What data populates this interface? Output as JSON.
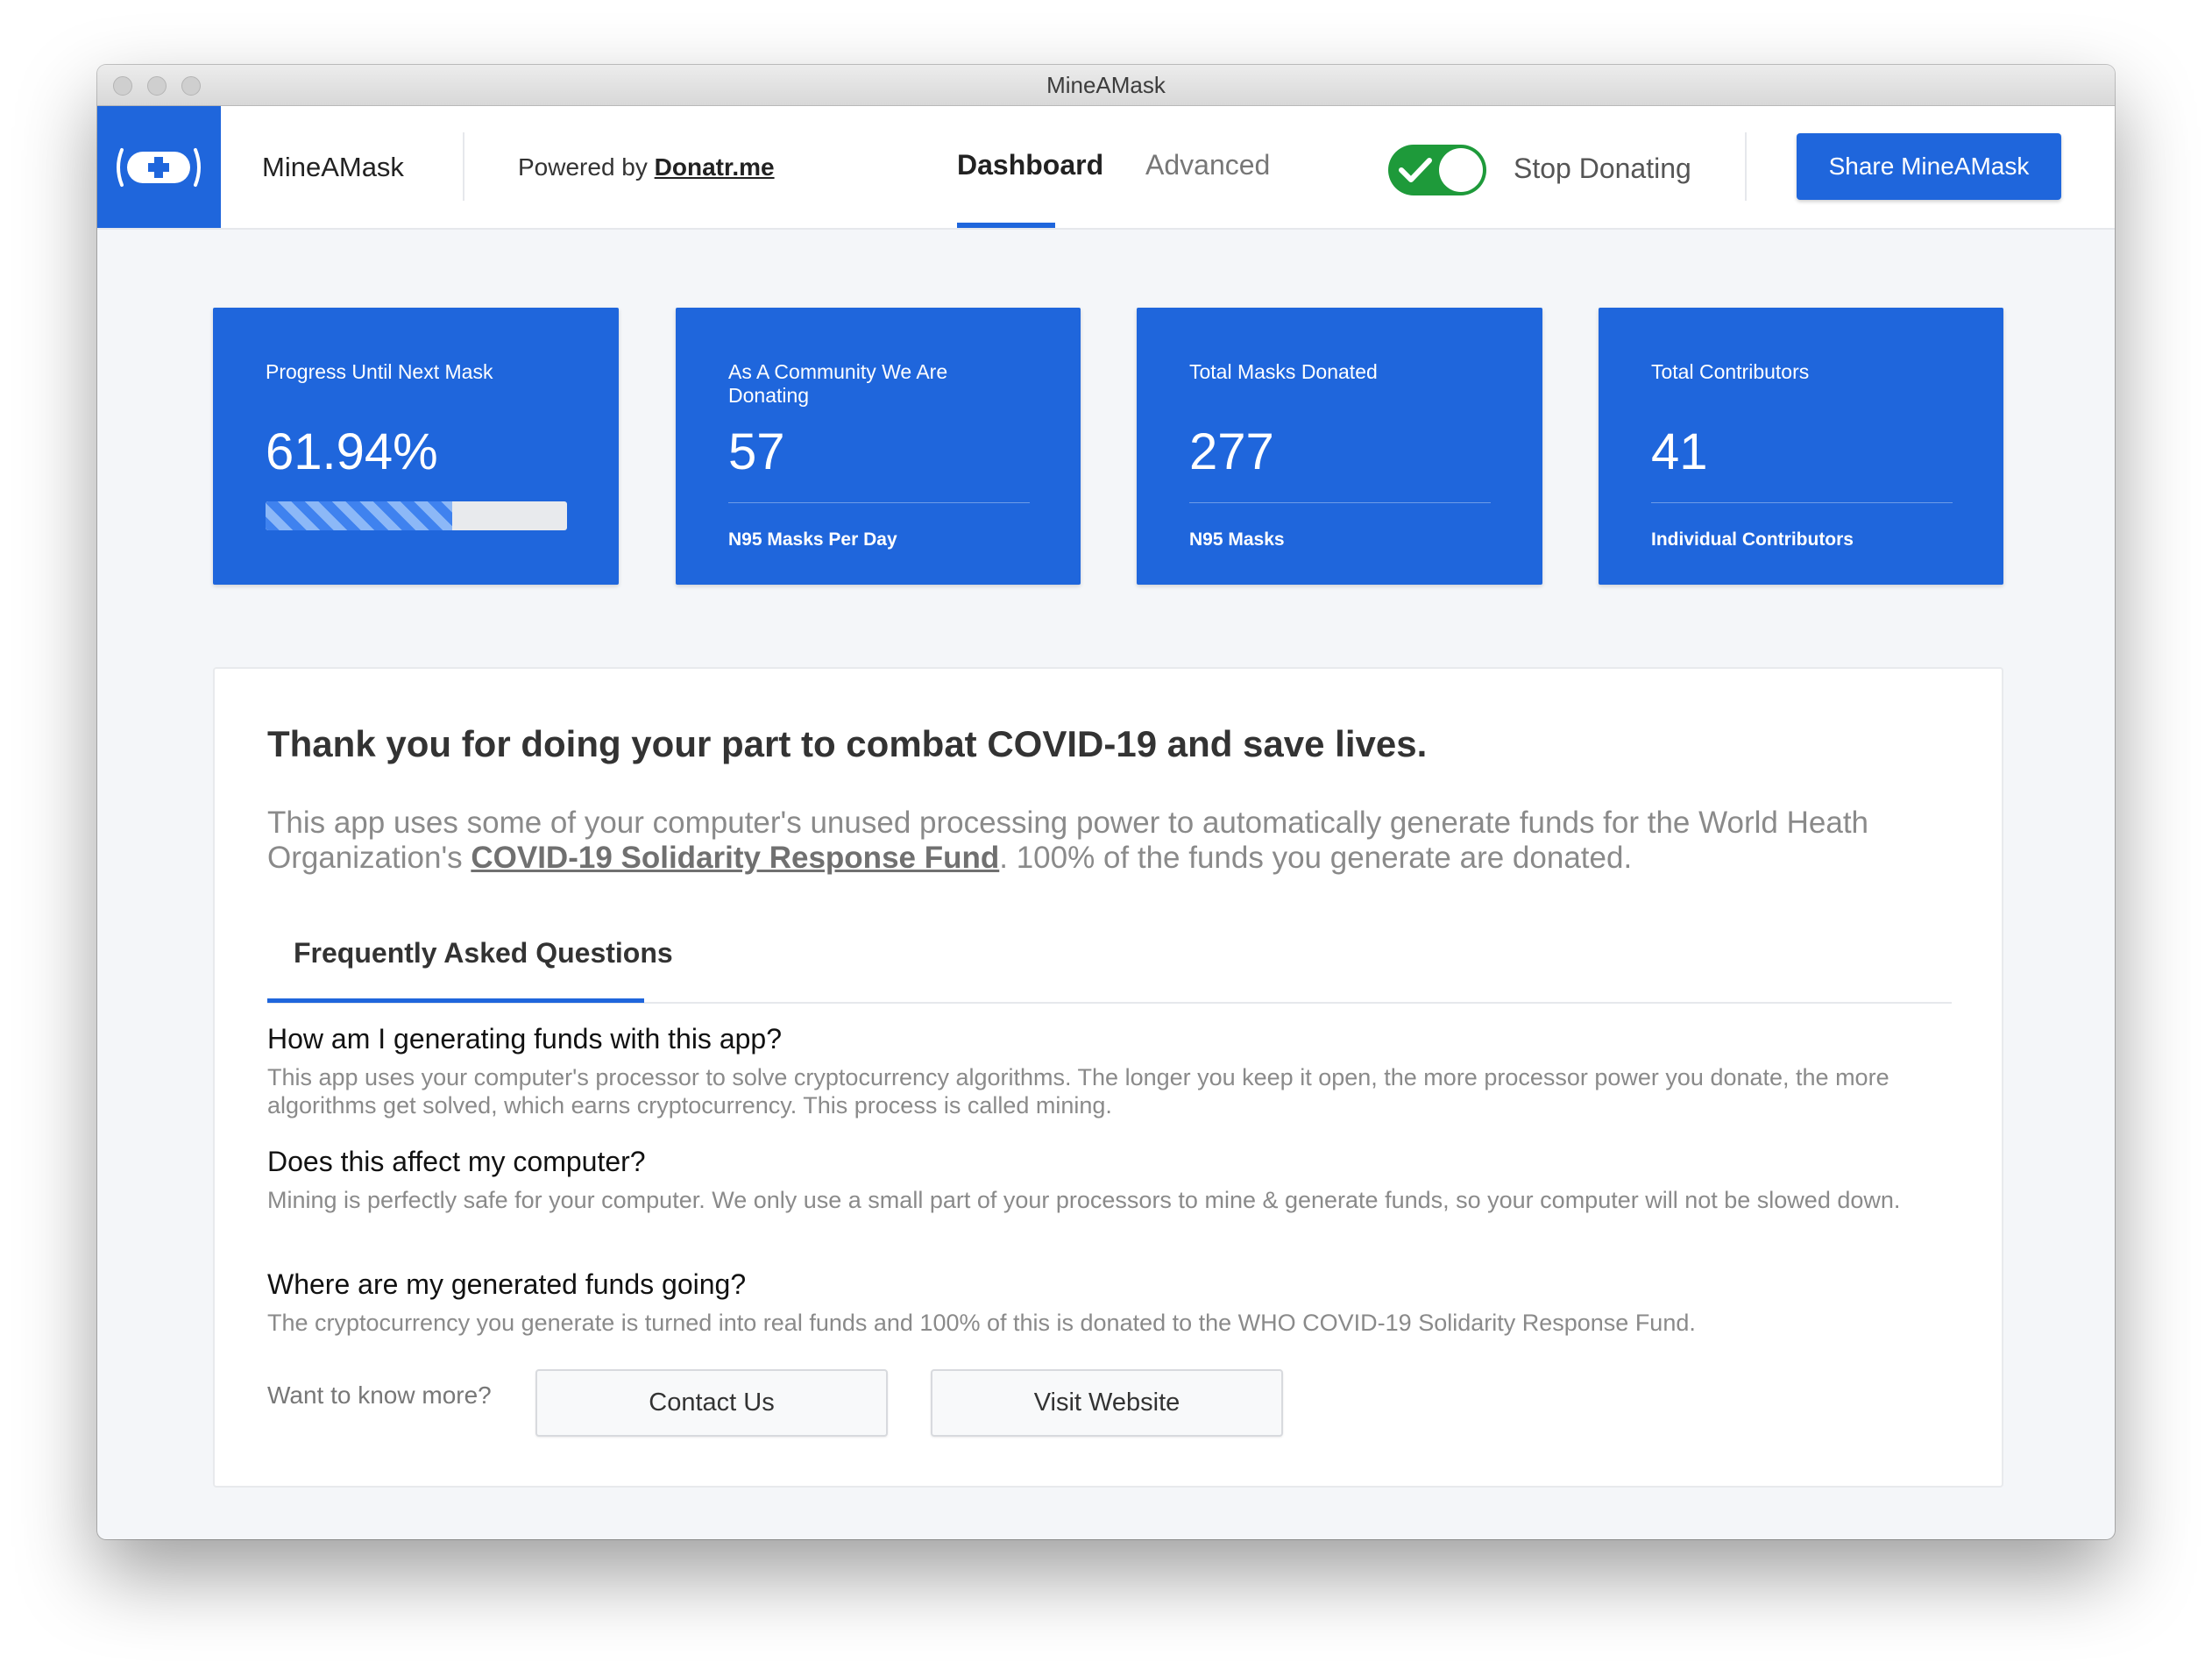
{
  "window": {
    "title": "MineAMask"
  },
  "header": {
    "brand": "MineAMask",
    "powered_prefix": "Powered by ",
    "powered_link": "Donatr.me",
    "tabs": [
      {
        "label": "Dashboard",
        "active": true
      },
      {
        "label": "Advanced",
        "active": false
      }
    ],
    "toggle": {
      "on": true,
      "label": "Stop Donating"
    },
    "share_button": "Share MineAMask"
  },
  "stats": [
    {
      "title": "Progress Until Next Mask",
      "value": "61.94%",
      "progress": 0.6194
    },
    {
      "title": "As A Community We Are Donating",
      "value": "57",
      "subtitle": "N95 Masks Per Day"
    },
    {
      "title": "Total Masks Donated",
      "value": "277",
      "subtitle": "N95 Masks"
    },
    {
      "title": "Total Contributors",
      "value": "41",
      "subtitle": "Individual Contributors"
    }
  ],
  "main": {
    "headline": "Thank you for doing your part to combat COVID-19 and save lives.",
    "intro_before": "This app uses some of your computer's unused processing power to automatically generate funds for the World Heath Organization's ",
    "intro_link": "COVID-19 Solidarity Response Fund",
    "intro_after": ". 100% of the funds you generate are donated.",
    "faq_tab": "Frequently Asked Questions",
    "faq": [
      {
        "q": "How am I generating funds with this app?",
        "a": "This app uses your computer's processor to solve cryptocurrency algorithms. The longer you keep it open, the more processor power you donate, the more algorithms get solved, which earns cryptocurrency. This process is called mining."
      },
      {
        "q": "Does this affect my computer?",
        "a": "Mining is perfectly safe for your computer. We only use a small part of your processors to mine & generate funds, so your computer will not be slowed down."
      },
      {
        "q": "Where are my generated funds going?",
        "a": "The cryptocurrency you generate is turned into real funds and 100% of this is donated to the WHO COVID-19 Solidarity Response Fund."
      }
    ],
    "more_label": "Want to know more?",
    "contact_button": "Contact Us",
    "website_button": "Visit Website"
  },
  "colors": {
    "accent": "#1f66dc",
    "toggle_on": "#1e9a3a"
  }
}
